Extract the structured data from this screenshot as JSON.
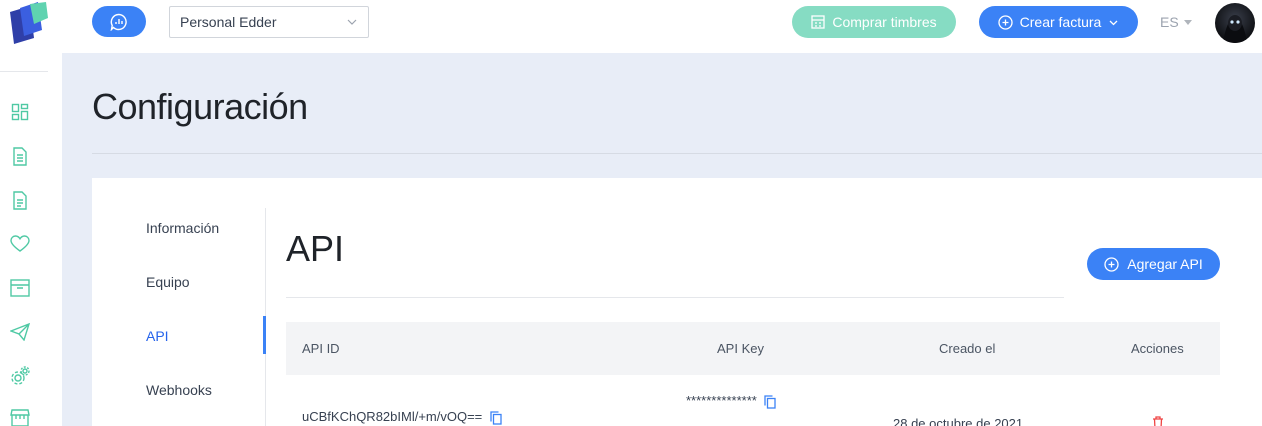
{
  "header": {
    "account_selected": "Personal Edder",
    "buy_label": "Comprar timbres",
    "create_label": "Crear factura",
    "language": "ES"
  },
  "colors": {
    "primary": "#3b82f6",
    "mint": "#86dcc3",
    "sidebar_icon": "#4fc9a4",
    "page_bg": "#e8edf7",
    "delete": "#ef4444"
  },
  "sidebar": {
    "icons": [
      "dashboard-icon",
      "document-icon",
      "document-list-icon",
      "heart-icon",
      "archive-icon",
      "send-icon",
      "settings-icon",
      "store-icon"
    ]
  },
  "page": {
    "title": "Configuración"
  },
  "subnav": {
    "items": [
      {
        "label": "Información"
      },
      {
        "label": "Equipo"
      },
      {
        "label": "API"
      },
      {
        "label": "Webhooks"
      }
    ],
    "active": "API"
  },
  "api": {
    "title": "API",
    "add_label": "Agregar API",
    "columns": [
      "API ID",
      "API Key",
      "Creado el",
      "Acciones"
    ],
    "rows": [
      {
        "api_id": "uCBfKChQR82bIMl/+m/vOQ==",
        "api_key": "**************",
        "created": "28 de octubre de 2021"
      }
    ]
  }
}
